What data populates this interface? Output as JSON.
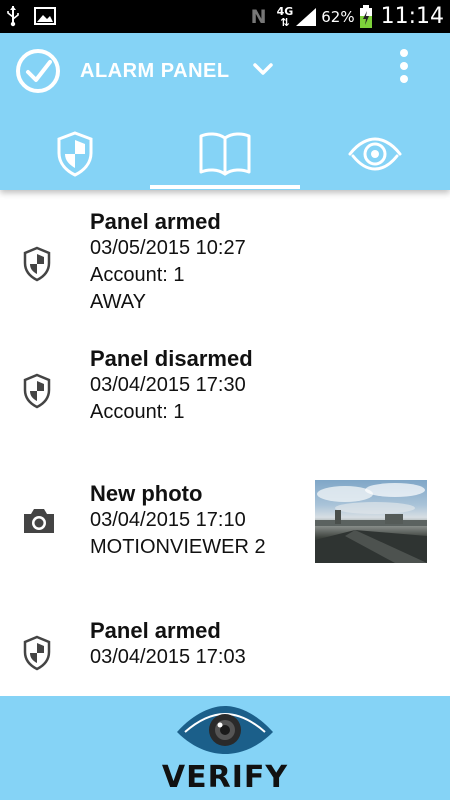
{
  "status_bar": {
    "network_label": "N",
    "network_type": "4G",
    "battery_percent": "62%",
    "time": "11:14"
  },
  "header": {
    "title": "ALARM PANEL",
    "tabs": [
      {
        "icon": "shield-icon"
      },
      {
        "icon": "book-icon",
        "active": true
      },
      {
        "icon": "eye-icon"
      }
    ]
  },
  "events": [
    {
      "title": "Panel armed",
      "datetime": "03/05/2015 10:27",
      "line3": "Account: 1",
      "line4": "AWAY",
      "icon": "shield-icon"
    },
    {
      "title": "Panel disarmed",
      "datetime": "03/04/2015 17:30",
      "line3": "Account: 1",
      "icon": "shield-icon"
    },
    {
      "title": "New photo",
      "datetime": "03/04/2015 17:10",
      "line3": "MOTIONVIEWER 2",
      "icon": "camera-icon",
      "has_thumbnail": true
    },
    {
      "title": "Panel armed",
      "datetime": "03/04/2015 17:03",
      "icon": "shield-icon"
    }
  ],
  "footer": {
    "brand": "VERIFY"
  },
  "colors": {
    "accent": "#85d3f6",
    "status_bar": "#000000",
    "text": "#111111"
  }
}
